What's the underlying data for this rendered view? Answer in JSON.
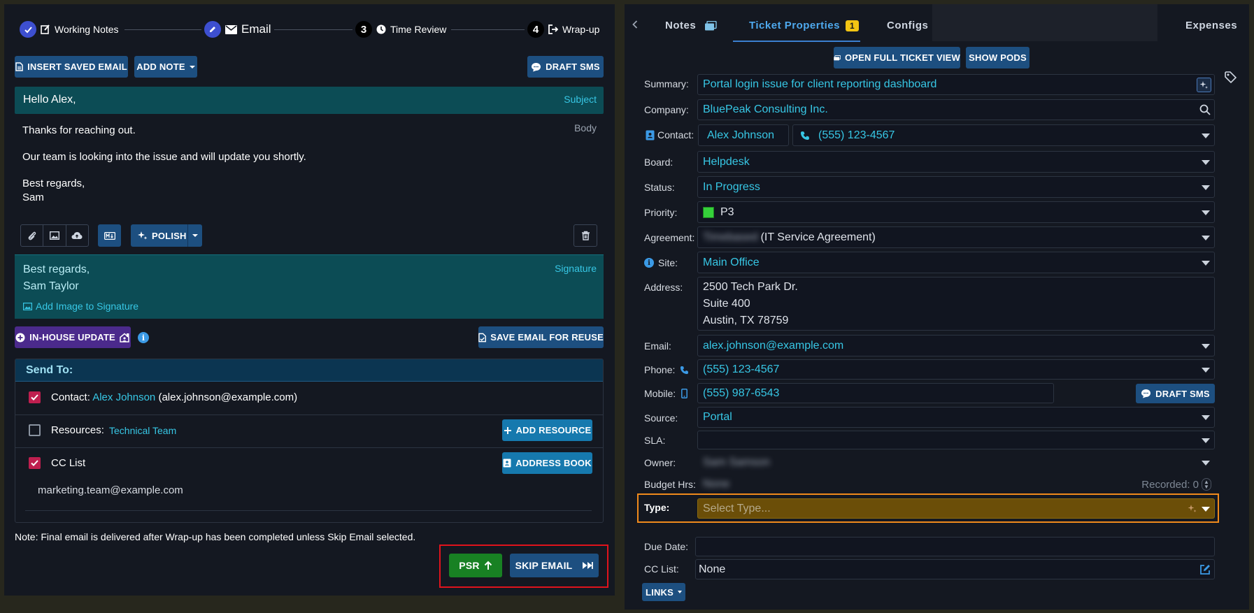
{
  "stepper": {
    "steps": [
      {
        "label": "Working Notes"
      },
      {
        "label": "Email"
      },
      {
        "number": "3",
        "label": "Time Review"
      },
      {
        "number": "4",
        "label": "Wrap-up"
      }
    ]
  },
  "toolbar": {
    "insert_saved_email": "INSERT SAVED EMAIL",
    "add_note": "ADD NOTE",
    "draft_sms": "DRAFT SMS"
  },
  "email": {
    "subject_value": "Hello Alex,",
    "subject_label": "Subject",
    "body_label": "Body",
    "body_lines": [
      "Thanks for reaching out.",
      "Our team is looking into the issue and will update you shortly.",
      "Best regards,",
      "Sam"
    ],
    "polish": "POLISH"
  },
  "signature": {
    "label": "Signature",
    "lines": [
      "Best regards,",
      "Sam Taylor"
    ],
    "add_image": "Add Image to Signature"
  },
  "actions": {
    "in_house_update": "IN-HOUSE UPDATE",
    "save_email": "SAVE EMAIL FOR REUSE"
  },
  "send_to": {
    "header": "Send To:",
    "contact_prefix": "Contact:",
    "contact_name": "Alex Johnson",
    "contact_email": "(alex.johnson@example.com)",
    "resources_label": "Resources:",
    "resources_value": "Technical Team",
    "add_resource": "ADD RESOURCE",
    "cc_label": "CC List",
    "address_book": "ADDRESS BOOK",
    "cc_email": "marketing.team@example.com"
  },
  "note": "Note: Final email is delivered after Wrap-up has been completed unless Skip Email selected.",
  "footer": {
    "psr": "PSR",
    "skip_email": "SKIP EMAIL"
  },
  "tabs": {
    "notes": "Notes",
    "ticket_properties": "Ticket Properties",
    "badge": "1",
    "configs": "Configs",
    "expenses": "Expenses"
  },
  "ticket_actions": {
    "open_full": "OPEN FULL TICKET VIEW",
    "show_pods": "SHOW PODS"
  },
  "props": {
    "summary_label": "Summary:",
    "summary": "Portal login issue for client reporting dashboard",
    "company_label": "Company:",
    "company": "BluePeak Consulting Inc.",
    "contact_label": "Contact:",
    "contact": "Alex Johnson",
    "contact_phone": "(555) 123-4567",
    "board_label": "Board:",
    "board": "Helpdesk",
    "status_label": "Status:",
    "status": "In Progress",
    "priority_label": "Priority:",
    "priority": "P3",
    "agreement_label": "Agreement:",
    "agreement_blur": "Timebased",
    "agreement": "(IT Service Agreement)",
    "site_label": "Site:",
    "site": "Main Office",
    "address_label": "Address:",
    "address_lines": [
      "2500 Tech Park Dr.",
      "Suite 400",
      "Austin, TX 78759"
    ],
    "email_label": "Email:",
    "email": "alex.johnson@example.com",
    "phone_label": "Phone:",
    "phone": "(555) 123-4567",
    "mobile_label": "Mobile:",
    "mobile": "(555) 987-6543",
    "draft_sms": "DRAFT SMS",
    "source_label": "Source:",
    "source": "Portal",
    "sla_label": "SLA:",
    "owner_label": "Owner:",
    "owner_blur": "Sam Samson",
    "budget_label": "Budget Hrs:",
    "budget_blur": "None",
    "recorded": "Recorded: 0",
    "type_label": "Type:",
    "type_placeholder": "Select Type...",
    "due_label": "Due Date:",
    "cc_label": "CC List:",
    "cc_value": "None",
    "links": "LINKS"
  },
  "colors": {
    "accent_cyan": "#37c7e5",
    "highlight_orange": "#f08a1c",
    "highlight_red": "#e0131c",
    "priority_green": "#35d13a"
  }
}
